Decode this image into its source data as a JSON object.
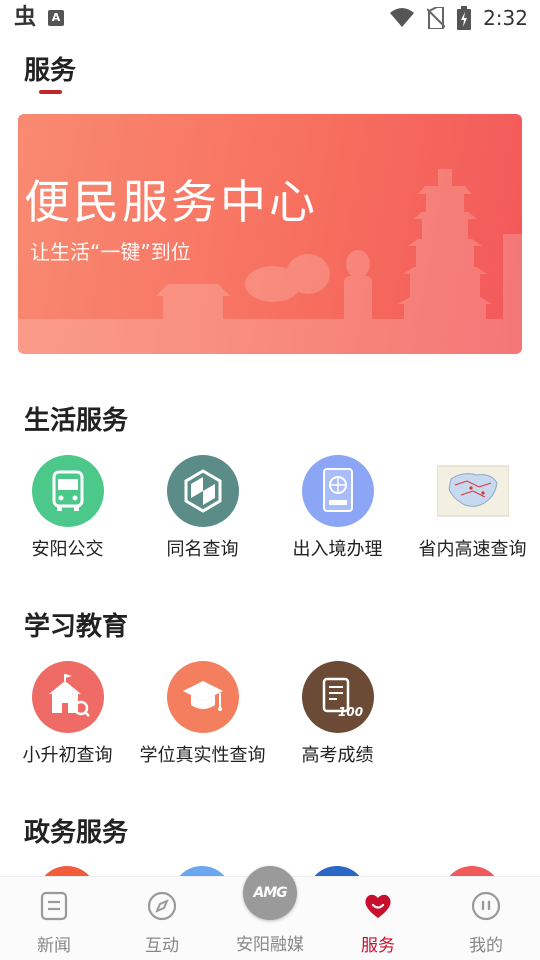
{
  "status_bar": {
    "app_icon_1": "虫",
    "app_icon_2": "A",
    "time": "2:32"
  },
  "page": {
    "title": "服务",
    "accent_color": "#c0272d"
  },
  "banner": {
    "title": "便民服务中心",
    "subtitle": "让生活“一键”到位"
  },
  "sections": {
    "life": {
      "title": "生活服务",
      "items": [
        {
          "label": "安阳公交",
          "icon": "bus-icon",
          "color": "#4cc98a"
        },
        {
          "label": "同名查询",
          "icon": "shield-icon",
          "color": "#5b8c88"
        },
        {
          "label": "出入境办理",
          "icon": "passport-icon",
          "color": "#8aa6f5"
        },
        {
          "label": "省内高速查询",
          "icon": "map-icon",
          "color": "#dbeaf7"
        }
      ]
    },
    "education": {
      "title": "学习教育",
      "items": [
        {
          "label": "小升初查询",
          "icon": "school-icon",
          "color": "#ee6b66"
        },
        {
          "label": "学位真实性查询",
          "icon": "graduation-cap-icon",
          "color": "#f47f5e"
        },
        {
          "label": "高考成绩",
          "icon": "score-sheet-icon",
          "color": "#6b4a36"
        }
      ]
    },
    "government": {
      "title": "政务服务"
    }
  },
  "bottom_nav": {
    "items": [
      {
        "label": "新闻",
        "icon": "news-icon"
      },
      {
        "label": "互动",
        "icon": "compass-icon"
      },
      {
        "label": "安阳融媒",
        "icon": "amg-logo-icon",
        "logo_text": "AMG"
      },
      {
        "label": "服务",
        "icon": "heart-icon",
        "active": true
      },
      {
        "label": "我的",
        "icon": "profile-icon"
      }
    ],
    "active_color": "#c8102e"
  }
}
